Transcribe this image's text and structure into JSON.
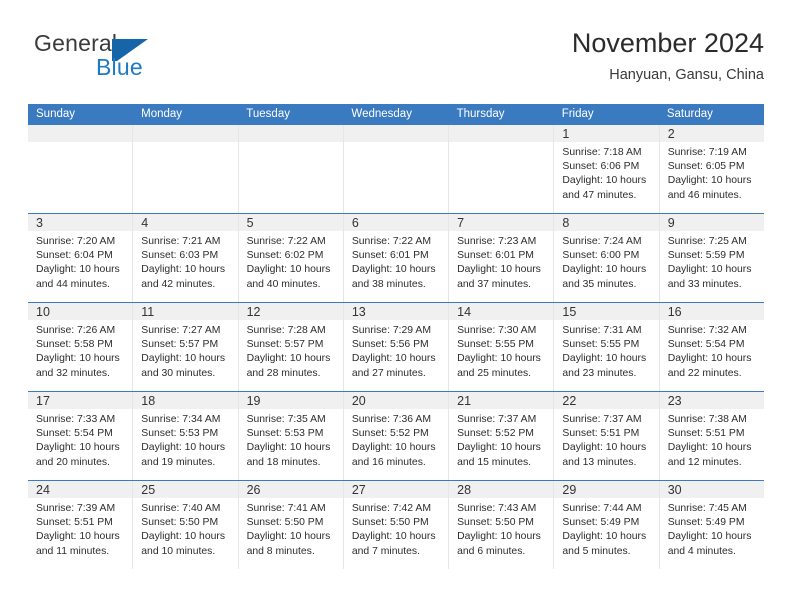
{
  "brand": {
    "name_part1": "General",
    "name_part2": "Blue",
    "mark": "flag-triangle-icon"
  },
  "header": {
    "title": "November 2024",
    "subtitle": "Hanyuan, Gansu, China"
  },
  "colors": {
    "header_blue": "#3a7ac0",
    "brand_blue": "#1f7ac4",
    "daynum_band": "#f0f0f0",
    "cell_border": "#e6e6e6"
  },
  "weekdays": [
    "Sunday",
    "Monday",
    "Tuesday",
    "Wednesday",
    "Thursday",
    "Friday",
    "Saturday"
  ],
  "weeks": [
    [
      {
        "day": "",
        "lines": []
      },
      {
        "day": "",
        "lines": []
      },
      {
        "day": "",
        "lines": []
      },
      {
        "day": "",
        "lines": []
      },
      {
        "day": "",
        "lines": []
      },
      {
        "day": "1",
        "lines": [
          "Sunrise: 7:18 AM",
          "Sunset: 6:06 PM",
          "Daylight: 10 hours",
          "and 47 minutes."
        ]
      },
      {
        "day": "2",
        "lines": [
          "Sunrise: 7:19 AM",
          "Sunset: 6:05 PM",
          "Daylight: 10 hours",
          "and 46 minutes."
        ]
      }
    ],
    [
      {
        "day": "3",
        "lines": [
          "Sunrise: 7:20 AM",
          "Sunset: 6:04 PM",
          "Daylight: 10 hours",
          "and 44 minutes."
        ]
      },
      {
        "day": "4",
        "lines": [
          "Sunrise: 7:21 AM",
          "Sunset: 6:03 PM",
          "Daylight: 10 hours",
          "and 42 minutes."
        ]
      },
      {
        "day": "5",
        "lines": [
          "Sunrise: 7:22 AM",
          "Sunset: 6:02 PM",
          "Daylight: 10 hours",
          "and 40 minutes."
        ]
      },
      {
        "day": "6",
        "lines": [
          "Sunrise: 7:22 AM",
          "Sunset: 6:01 PM",
          "Daylight: 10 hours",
          "and 38 minutes."
        ]
      },
      {
        "day": "7",
        "lines": [
          "Sunrise: 7:23 AM",
          "Sunset: 6:01 PM",
          "Daylight: 10 hours",
          "and 37 minutes."
        ]
      },
      {
        "day": "8",
        "lines": [
          "Sunrise: 7:24 AM",
          "Sunset: 6:00 PM",
          "Daylight: 10 hours",
          "and 35 minutes."
        ]
      },
      {
        "day": "9",
        "lines": [
          "Sunrise: 7:25 AM",
          "Sunset: 5:59 PM",
          "Daylight: 10 hours",
          "and 33 minutes."
        ]
      }
    ],
    [
      {
        "day": "10",
        "lines": [
          "Sunrise: 7:26 AM",
          "Sunset: 5:58 PM",
          "Daylight: 10 hours",
          "and 32 minutes."
        ]
      },
      {
        "day": "11",
        "lines": [
          "Sunrise: 7:27 AM",
          "Sunset: 5:57 PM",
          "Daylight: 10 hours",
          "and 30 minutes."
        ]
      },
      {
        "day": "12",
        "lines": [
          "Sunrise: 7:28 AM",
          "Sunset: 5:57 PM",
          "Daylight: 10 hours",
          "and 28 minutes."
        ]
      },
      {
        "day": "13",
        "lines": [
          "Sunrise: 7:29 AM",
          "Sunset: 5:56 PM",
          "Daylight: 10 hours",
          "and 27 minutes."
        ]
      },
      {
        "day": "14",
        "lines": [
          "Sunrise: 7:30 AM",
          "Sunset: 5:55 PM",
          "Daylight: 10 hours",
          "and 25 minutes."
        ]
      },
      {
        "day": "15",
        "lines": [
          "Sunrise: 7:31 AM",
          "Sunset: 5:55 PM",
          "Daylight: 10 hours",
          "and 23 minutes."
        ]
      },
      {
        "day": "16",
        "lines": [
          "Sunrise: 7:32 AM",
          "Sunset: 5:54 PM",
          "Daylight: 10 hours",
          "and 22 minutes."
        ]
      }
    ],
    [
      {
        "day": "17",
        "lines": [
          "Sunrise: 7:33 AM",
          "Sunset: 5:54 PM",
          "Daylight: 10 hours",
          "and 20 minutes."
        ]
      },
      {
        "day": "18",
        "lines": [
          "Sunrise: 7:34 AM",
          "Sunset: 5:53 PM",
          "Daylight: 10 hours",
          "and 19 minutes."
        ]
      },
      {
        "day": "19",
        "lines": [
          "Sunrise: 7:35 AM",
          "Sunset: 5:53 PM",
          "Daylight: 10 hours",
          "and 18 minutes."
        ]
      },
      {
        "day": "20",
        "lines": [
          "Sunrise: 7:36 AM",
          "Sunset: 5:52 PM",
          "Daylight: 10 hours",
          "and 16 minutes."
        ]
      },
      {
        "day": "21",
        "lines": [
          "Sunrise: 7:37 AM",
          "Sunset: 5:52 PM",
          "Daylight: 10 hours",
          "and 15 minutes."
        ]
      },
      {
        "day": "22",
        "lines": [
          "Sunrise: 7:37 AM",
          "Sunset: 5:51 PM",
          "Daylight: 10 hours",
          "and 13 minutes."
        ]
      },
      {
        "day": "23",
        "lines": [
          "Sunrise: 7:38 AM",
          "Sunset: 5:51 PM",
          "Daylight: 10 hours",
          "and 12 minutes."
        ]
      }
    ],
    [
      {
        "day": "24",
        "lines": [
          "Sunrise: 7:39 AM",
          "Sunset: 5:51 PM",
          "Daylight: 10 hours",
          "and 11 minutes."
        ]
      },
      {
        "day": "25",
        "lines": [
          "Sunrise: 7:40 AM",
          "Sunset: 5:50 PM",
          "Daylight: 10 hours",
          "and 10 minutes."
        ]
      },
      {
        "day": "26",
        "lines": [
          "Sunrise: 7:41 AM",
          "Sunset: 5:50 PM",
          "Daylight: 10 hours",
          "and 8 minutes."
        ]
      },
      {
        "day": "27",
        "lines": [
          "Sunrise: 7:42 AM",
          "Sunset: 5:50 PM",
          "Daylight: 10 hours",
          "and 7 minutes."
        ]
      },
      {
        "day": "28",
        "lines": [
          "Sunrise: 7:43 AM",
          "Sunset: 5:50 PM",
          "Daylight: 10 hours",
          "and 6 minutes."
        ]
      },
      {
        "day": "29",
        "lines": [
          "Sunrise: 7:44 AM",
          "Sunset: 5:49 PM",
          "Daylight: 10 hours",
          "and 5 minutes."
        ]
      },
      {
        "day": "30",
        "lines": [
          "Sunrise: 7:45 AM",
          "Sunset: 5:49 PM",
          "Daylight: 10 hours",
          "and 4 minutes."
        ]
      }
    ]
  ]
}
